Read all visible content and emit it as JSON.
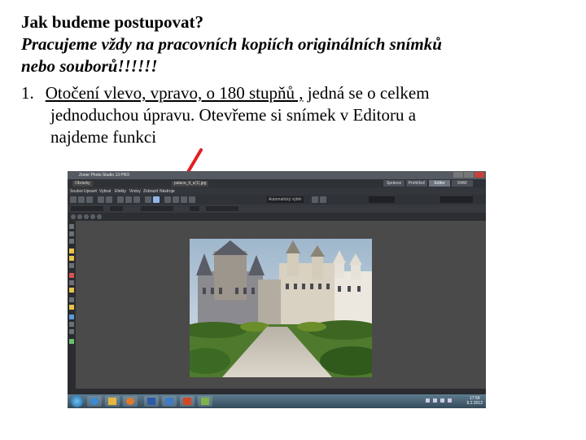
{
  "heading": "Jak budeme postupovat?",
  "intro_line1": "Pracujeme vždy na pracovních kopiích originálních snímků",
  "intro_line2": "nebo souborů!!!!!!",
  "step": {
    "number": "1.",
    "underlined": "Otočení vlevo, vpravo, o 180 stupňů ,",
    "rest": " jedná se o celkem",
    "line2": "jednoduchou úpravu. Otevřeme si snímek v Editoru a",
    "line3": "najdeme funkci"
  },
  "screenshot": {
    "title": "Zoner Photo Studio 13 PRO",
    "tabs": [
      "Obrázky",
      "palace_lt_s(1).jpg"
    ],
    "modes": [
      "Správce",
      "Prohlížeč",
      "Editor",
      "RAW"
    ],
    "active_mode": "Editor",
    "menu": [
      "Soubor",
      "Upravit",
      "Vybrat",
      "Efekty",
      "Vrstvy",
      "Zobrazit",
      "Nástroje"
    ],
    "toolbar_field": "Automatický výběr",
    "clock_time": "17:59",
    "clock_date": "9.2.2012"
  },
  "colors": {
    "arrow": "#e31e24",
    "app_bg": "#3b3b3b",
    "canvas_bg": "#4a4a4a"
  }
}
